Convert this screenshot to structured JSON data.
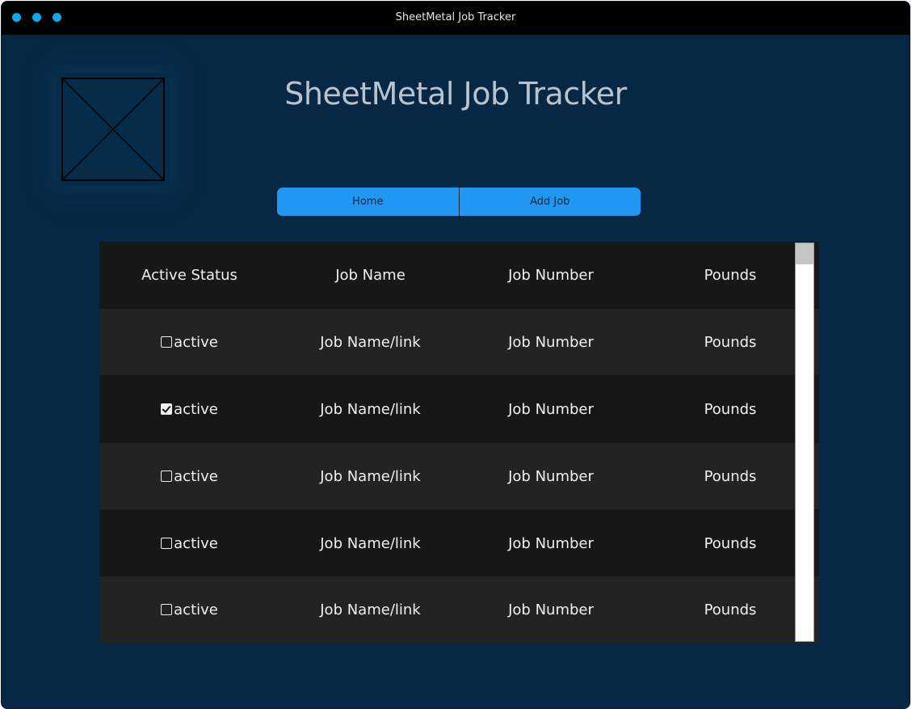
{
  "window": {
    "title": "SheetMetal Job Tracker",
    "traffic_light_color": "#10a7ef"
  },
  "header": {
    "logo_icon": "image-placeholder-icon",
    "heading": "SheetMetal Job Tracker"
  },
  "nav": {
    "home_label": "Home",
    "add_job_label": "Add Job",
    "accent_color": "#2196f3"
  },
  "table": {
    "columns": [
      "Active Status",
      "Job Name",
      "Job Number",
      "Pounds"
    ],
    "rows": [
      {
        "checked": false,
        "status": "active",
        "job_name": "Job Name/link",
        "job_number": "Job Number",
        "pounds": "Pounds"
      },
      {
        "checked": true,
        "status": "active",
        "job_name": "Job Name/link",
        "job_number": "Job Number",
        "pounds": "Pounds"
      },
      {
        "checked": false,
        "status": "active",
        "job_name": "Job Name/link",
        "job_number": "Job Number",
        "pounds": "Pounds"
      },
      {
        "checked": false,
        "status": "active",
        "job_name": "Job Name/link",
        "job_number": "Job Number",
        "pounds": "Pounds"
      },
      {
        "checked": false,
        "status": "active",
        "job_name": "Job Name/link",
        "job_number": "Job Number",
        "pounds": "Pounds"
      }
    ],
    "row_colors": [
      "#171717",
      "#232323"
    ]
  },
  "colors": {
    "background": "#062844",
    "titlebar": "#000000"
  }
}
